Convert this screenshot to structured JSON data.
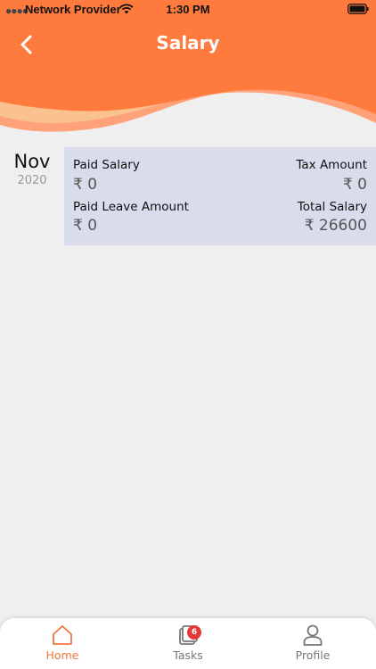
{
  "status_bar": {
    "carrier": "Network Provider",
    "time": "1:30 PM"
  },
  "header": {
    "title": "Salary",
    "back_icon": "chevron-left-icon",
    "colors": {
      "primary": "#ff7a3d",
      "wave_light": "#f9c28f",
      "wave_mid": "#ffa27a"
    }
  },
  "salary_entries": [
    {
      "month": "Nov",
      "year": "2020",
      "paid_salary_label": "Paid Salary",
      "paid_salary_value": "₹ 0",
      "tax_amount_label": "Tax Amount",
      "tax_amount_value": "₹ 0",
      "paid_leave_label": "Paid Leave Amount",
      "paid_leave_value": "₹ 0",
      "total_salary_label": "Total Salary",
      "total_salary_value": "₹ 26600"
    }
  ],
  "bottom_nav": {
    "home": {
      "label": "Home",
      "icon": "home-icon"
    },
    "tasks": {
      "label": "Tasks",
      "icon": "tasks-icon",
      "badge": "6"
    },
    "profile": {
      "label": "Profile",
      "icon": "profile-icon"
    }
  }
}
